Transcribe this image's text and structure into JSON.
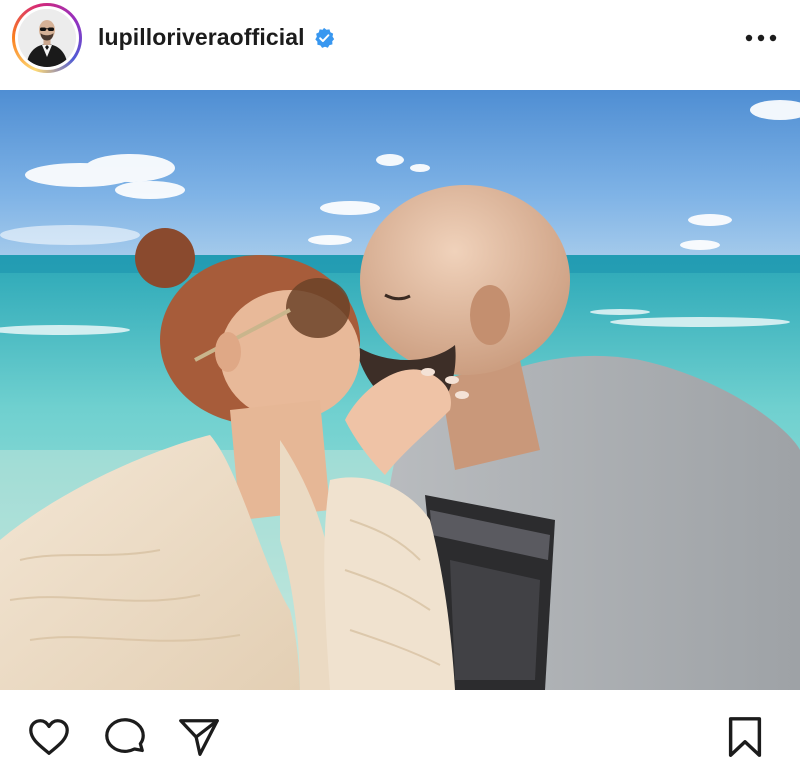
{
  "header": {
    "username": "lupilloriveraofficial",
    "verified": true,
    "avatar_icon": "profile-avatar",
    "more_icon": "more-options-icon"
  },
  "photo": {
    "subject": "couple-kissing-beach-selfie"
  },
  "actions": {
    "like_icon": "heart-icon",
    "comment_icon": "comment-icon",
    "share_icon": "paper-plane-icon",
    "save_icon": "bookmark-icon"
  },
  "colors": {
    "verified": "#3897f0",
    "text": "#1c1c1c",
    "icon": "#1c1c1c"
  }
}
